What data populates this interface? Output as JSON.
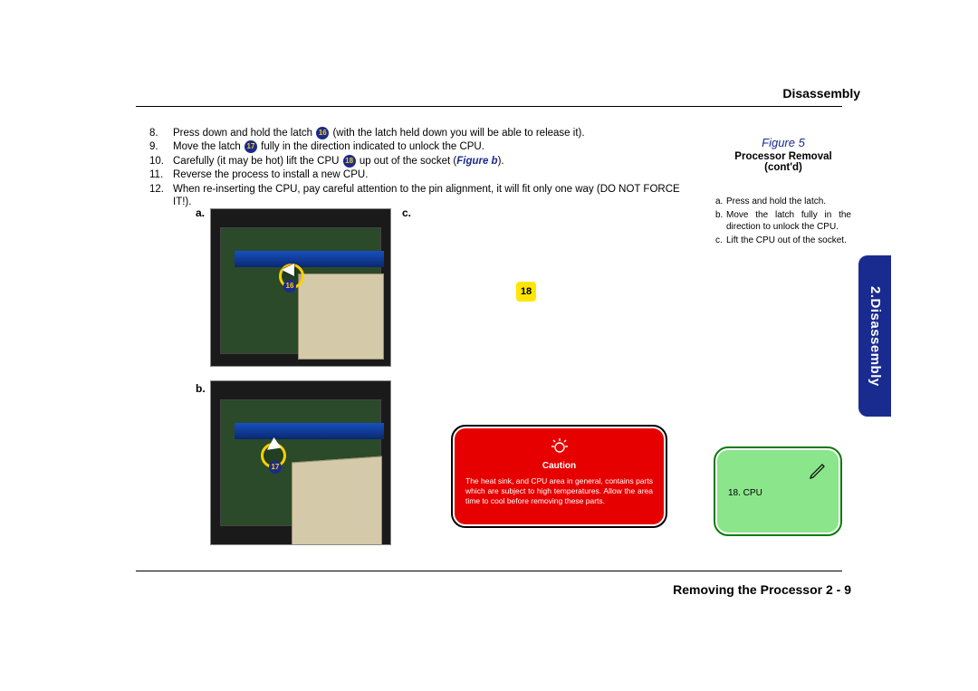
{
  "header": {
    "title": "Disassembly"
  },
  "side_tab": "2.Disassembly",
  "steps": [
    {
      "n": "8.",
      "pre": "Press down and hold the latch ",
      "badge": "16",
      "post": " (with the latch held down you will be able to release it)."
    },
    {
      "n": "9.",
      "pre": "Move the latch ",
      "badge": "17",
      "post": " fully in the direction indicated to unlock the CPU."
    },
    {
      "n": "10.",
      "pre": "Carefully (it may be hot) lift the CPU ",
      "badge": "18",
      "post_a": " up out of the socket (",
      "figref": "Figure b",
      "post_b": ")."
    },
    {
      "n": "11.",
      "text": "Reverse the process to install a new CPU."
    },
    {
      "n": "12.",
      "text": "When re-inserting the CPU, pay careful attention to the pin alignment, it will fit only one way (DO NOT FORCE IT!)."
    }
  ],
  "fig_labels": {
    "a": "a.",
    "b": "b.",
    "c": "c."
  },
  "mini_badges": {
    "a": "16",
    "b": "17"
  },
  "yellow_badge": "18",
  "sidebar": {
    "fig_label": "Figure 5",
    "title_line1": "Processor Removal",
    "title_line2": "(cont'd)",
    "items": [
      {
        "lbl": "a.",
        "txt": "Press and hold the latch."
      },
      {
        "lbl": "b.",
        "txt": "Move the latch fully in the direction to unlock the CPU."
      },
      {
        "lbl": "c.",
        "txt": "Lift the CPU out of the socket."
      }
    ]
  },
  "caution": {
    "title": "Caution",
    "body": "The heat sink, and CPU area in general, contains parts which are subject to high temperatures. Allow the area time to cool before removing these parts."
  },
  "cpu_box": {
    "text": "18. CPU"
  },
  "footer": {
    "title": "Removing the Processor  2  -  9"
  }
}
